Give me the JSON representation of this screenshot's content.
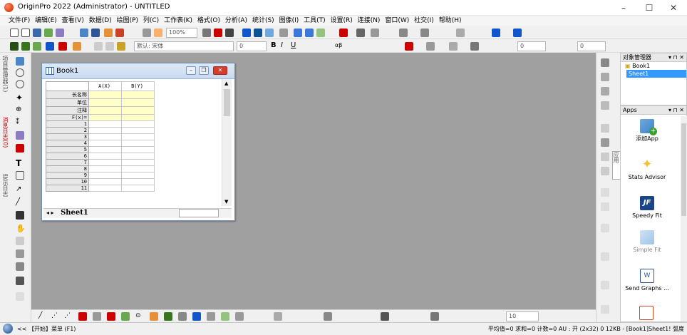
{
  "window": {
    "title": "OriginPro 2022 (Administrator) - UNTITLED",
    "min": "–",
    "max": "☐",
    "close": "✕"
  },
  "menu": [
    "文件(F)",
    "编辑(E)",
    "查看(V)",
    "数据(D)",
    "绘图(P)",
    "列(C)",
    "工作表(K)",
    "格式(O)",
    "分析(A)",
    "统计(S)",
    "图像(I)",
    "工具(T)",
    "设置(R)",
    "连接(N)",
    "窗口(W)",
    "社交(I)",
    "帮助(H)"
  ],
  "toolbar": {
    "zoom": "100%",
    "font": "默认: 宋体",
    "size": "0",
    "size2": "0",
    "width": "0"
  },
  "left_tabs": {
    "project": "项目管理器(1)",
    "messages": "消息日志(0)",
    "hints": "提示日志"
  },
  "book": {
    "title": "Book1",
    "col_a": "A(X)",
    "col_b": "B(Y)",
    "row_labels": [
      "长名称",
      "单位",
      "注释",
      "F(x)="
    ],
    "rows": [
      "1",
      "2",
      "3",
      "4",
      "5",
      "6",
      "7",
      "8",
      "9",
      "10",
      "11"
    ],
    "sheet_tab": "Sheet1"
  },
  "object_manager": {
    "title": "对象管理器",
    "items": [
      "Book1",
      "Sheet1"
    ],
    "btns": "▾ ⊓ ✕"
  },
  "apps": {
    "title": "Apps",
    "side_tab": "应用",
    "items": [
      "添加App",
      "Stats Advisor",
      "Speedy Fit",
      "Simple Fit",
      "Send Graphs ..."
    ]
  },
  "status": {
    "left": "<< 【开始】菜单 (F1)",
    "right": "平均值=0 求和=0 计数=0 AU : 开 (2x32) 0 12KB - [Book1]Sheet1! 弧度"
  },
  "colors": {
    "accent": "#3399ff",
    "workspace": "#a0a0a0",
    "header_yellow": "#ffffc8",
    "close_red": "#d83c2a"
  }
}
